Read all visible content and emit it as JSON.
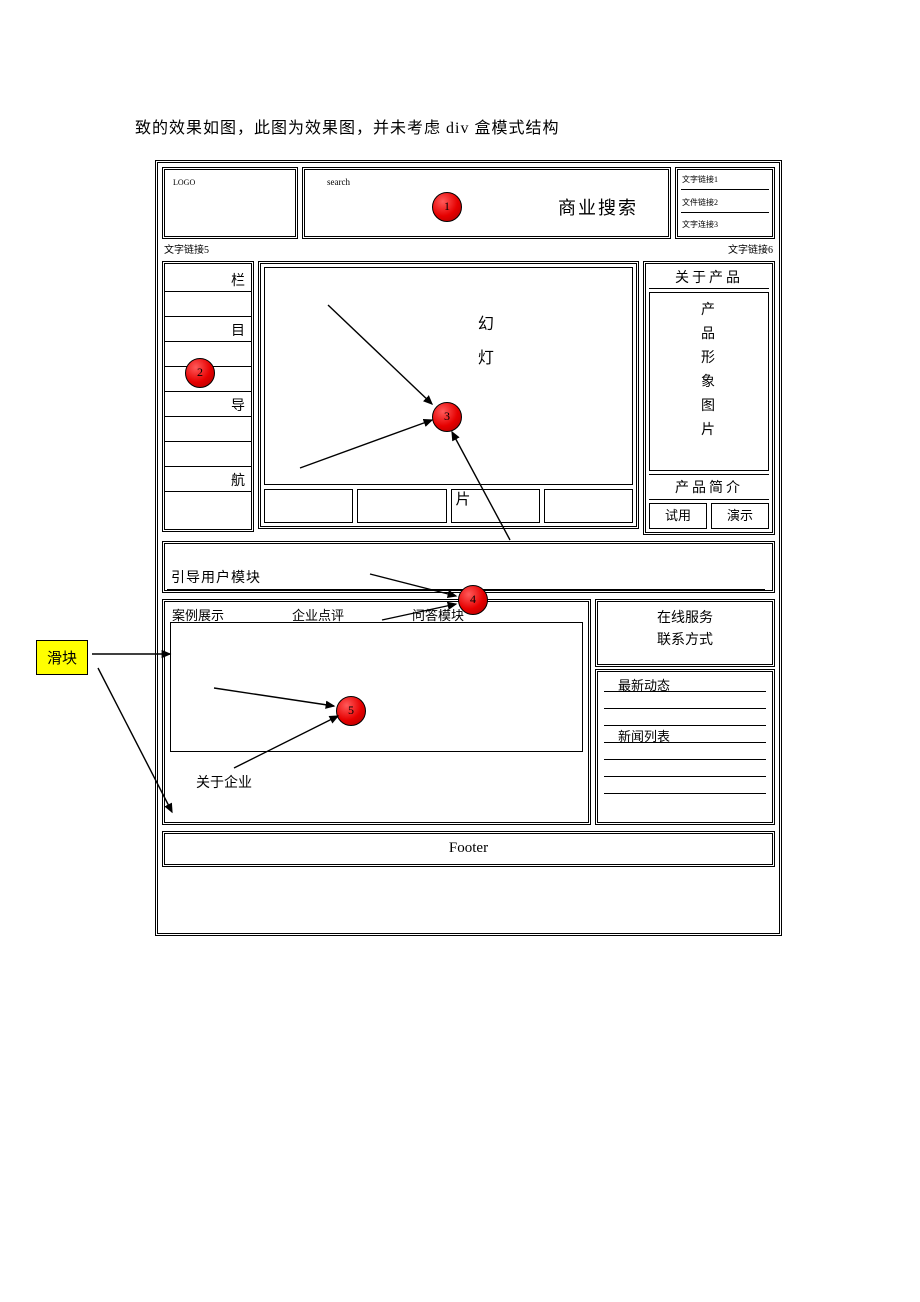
{
  "caption": "致的效果如图，此图为效果图，并未考虑 div 盒模式结构",
  "header": {
    "logo": "LOGO",
    "search_label": "search",
    "search_title": "商业搜索",
    "links": [
      "文字链接1",
      "文件链接2",
      "文字连接3"
    ],
    "subleft": "文字链接5",
    "subright": "文字链接6"
  },
  "nav": [
    "栏",
    "目",
    "导",
    "航"
  ],
  "slideshow": {
    "vertical": "幻\n灯",
    "thumb_extra": "片"
  },
  "product": {
    "title": "关于产品",
    "image_text": "产\n品\n形\n象\n图\n片",
    "intro": "产品简介",
    "try": "试用",
    "demo": "演示"
  },
  "guide": "引导用户模块",
  "tabs": {
    "case": "案例展示",
    "review": "企业点评",
    "qa": "问答模块",
    "about": "关于企业"
  },
  "service": {
    "online": "在线服务",
    "contact": "联系方式",
    "news_latest": "最新动态",
    "news_list": "新闻列表"
  },
  "footer": "Footer",
  "callouts": {
    "c1": "1",
    "c2": "2",
    "c3": "3",
    "c4": "4",
    "c5": "5"
  },
  "slider_label": "滑块"
}
